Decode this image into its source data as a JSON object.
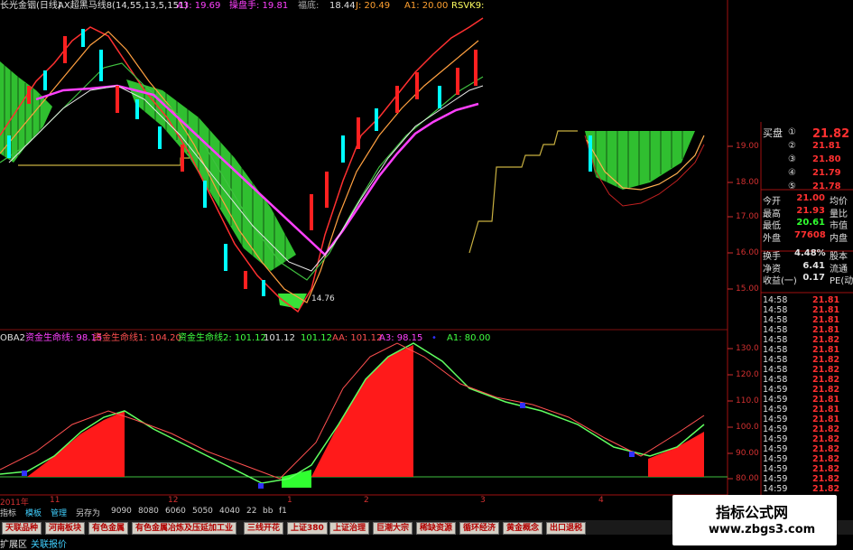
{
  "header": {
    "title": "长光金铟(日线)",
    "indicator": "AX超黑马线8(14,55,13,5,151)",
    "a3_label": "A3: 19.69",
    "operator_label": "操盘手: 19.81",
    "fbd_label": "福底:",
    "v1": "18.44",
    "j_label": "J: 20.49",
    "a1_label": "A1: 20.00",
    "rsvk_label": "RSVK9:"
  },
  "lower_header": {
    "name": "OBA2",
    "line1": "资金生命线: 98.15",
    "line1b": "资金生命线1: 104.20",
    "line2": "资金生命线2: 101.12",
    "line2v": "101.12",
    "line3": "101.12",
    "aa": "AA: 101.12",
    "a3": "A3: 98.15",
    "dot": "•",
    "a1": "A1: 80.00"
  },
  "price_axis": [
    "19.00",
    "18.00",
    "17.00",
    "16.00",
    "15.00"
  ],
  "osc_axis": [
    "130.0",
    "120.0",
    "110.0",
    "100.0",
    "90.00",
    "80.00"
  ],
  "low_label": "14.76",
  "date_axis": [
    "2011年",
    "11",
    "12",
    "1",
    "2",
    "3",
    "4"
  ],
  "order_book": {
    "buy_label": "买盘",
    "rows": [
      {
        "idx": "①",
        "price": "21.82"
      },
      {
        "idx": "②",
        "price": "21.81"
      },
      {
        "idx": "③",
        "price": "21.80"
      },
      {
        "idx": "④",
        "price": "21.79"
      },
      {
        "idx": "⑤",
        "price": "21.78"
      }
    ]
  },
  "quote": [
    {
      "k": "今开",
      "v": "21.00",
      "k2": "均价",
      "c": "#ff3030"
    },
    {
      "k": "最高",
      "v": "21.93",
      "k2": "量比",
      "c": "#ff3030"
    },
    {
      "k": "最低",
      "v": "20.61",
      "k2": "市值",
      "c": "#30ff30"
    },
    {
      "k": "外盘",
      "v": "77608",
      "k2": "内盘",
      "c": "#ff3030"
    },
    {
      "k": "换手",
      "v": "4.48%",
      "k2": "股本",
      "c": "#e0e0e0"
    },
    {
      "k": "净资",
      "v": "6.41",
      "k2": "流通",
      "c": "#e0e0e0"
    },
    {
      "k": "收益(一)",
      "v": "0.17",
      "k2": "PE(动",
      "c": "#e0e0e0"
    }
  ],
  "ticks": [
    {
      "t": "14:58",
      "p": "21.81"
    },
    {
      "t": "14:58",
      "p": "21.81"
    },
    {
      "t": "14:58",
      "p": "21.81"
    },
    {
      "t": "14:58",
      "p": "21.81"
    },
    {
      "t": "14:58",
      "p": "21.82"
    },
    {
      "t": "14:58",
      "p": "21.81"
    },
    {
      "t": "14:58",
      "p": "21.82"
    },
    {
      "t": "14:58",
      "p": "21.82"
    },
    {
      "t": "14:58",
      "p": "21.82"
    },
    {
      "t": "14:59",
      "p": "21.82"
    },
    {
      "t": "14:59",
      "p": "21.81"
    },
    {
      "t": "14:59",
      "p": "21.81"
    },
    {
      "t": "14:59",
      "p": "21.81"
    },
    {
      "t": "14:59",
      "p": "21.82"
    },
    {
      "t": "14:59",
      "p": "21.82"
    },
    {
      "t": "14:59",
      "p": "21.82"
    },
    {
      "t": "14:59",
      "p": "21.82"
    },
    {
      "t": "14:59",
      "p": "21.82"
    },
    {
      "t": "14:59",
      "p": "21.82"
    },
    {
      "t": "14:59",
      "p": "21.82"
    }
  ],
  "controls": [
    "指标",
    "模板",
    "管理",
    "另存为",
    "9090",
    "8080",
    "6060",
    "5050",
    "4040",
    "22",
    "bb",
    "f1"
  ],
  "tabs": [
    "天联品种",
    "河南板块",
    "有色金属",
    "有色金属冶炼及压延加工业",
    "三线开花",
    "上证380",
    "上证治理",
    "巨潮大宗",
    "稀缺资源",
    "循环经济",
    "黄金概念",
    "出口退税"
  ],
  "footer": {
    "left": "扩展区",
    "link": "关联报价"
  },
  "watermark": {
    "title": "指标公式网",
    "url": "www.zbgs3.com"
  },
  "colors": {
    "up": "#ff2020",
    "down": "#00ffff",
    "band": "#40ff40",
    "accent": "#ff2020"
  }
}
